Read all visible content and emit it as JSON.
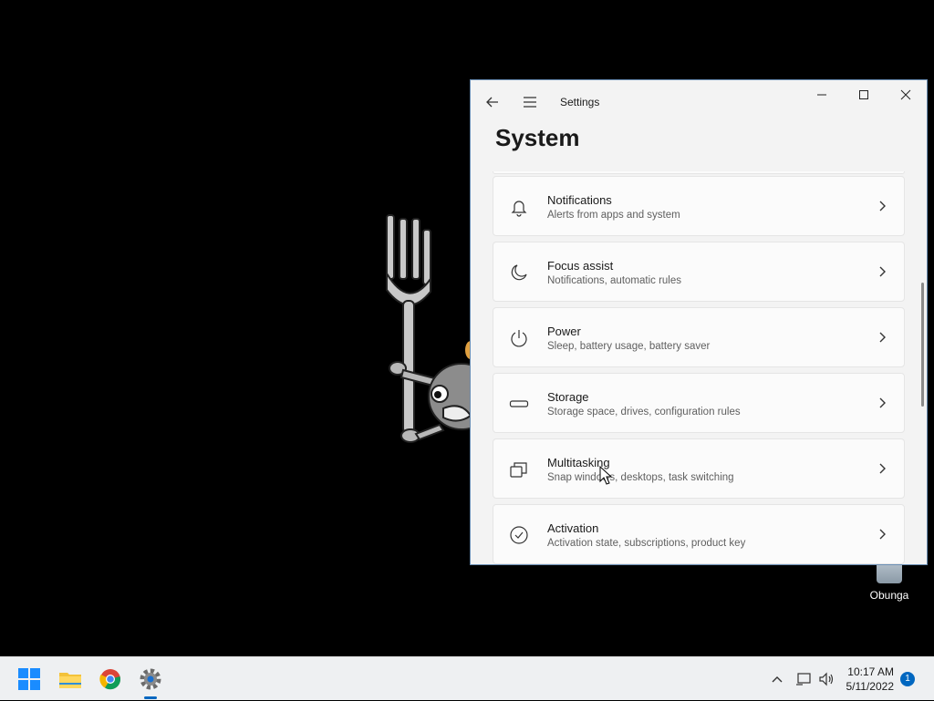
{
  "window": {
    "title": "Settings",
    "page_title": "System"
  },
  "settings_items": [
    {
      "name": "Notifications",
      "desc": "Alerts from apps and system",
      "icon": "bell-icon"
    },
    {
      "name": "Focus assist",
      "desc": "Notifications, automatic rules",
      "icon": "moon-icon"
    },
    {
      "name": "Power",
      "desc": "Sleep, battery usage, battery saver",
      "icon": "power-icon"
    },
    {
      "name": "Storage",
      "desc": "Storage space, drives, configuration rules",
      "icon": "storage-icon"
    },
    {
      "name": "Multitasking",
      "desc": "Snap windows, desktops, task switching",
      "icon": "multitasking-icon"
    },
    {
      "name": "Activation",
      "desc": "Activation state, subscriptions, product key",
      "icon": "check-circle-icon"
    }
  ],
  "desktop": {
    "icon_label": "Obunga"
  },
  "taskbar": {
    "apps": [
      "start-icon",
      "file-explorer-icon",
      "chrome-icon",
      "settings-icon"
    ],
    "time": "10:17 AM",
    "date": "5/11/2022",
    "notification_count": "1"
  },
  "colors": {
    "accent": "#0067c0",
    "window_border": "#6b8fb5",
    "window_bg": "#f3f3f3",
    "card_bg": "#fbfbfb"
  }
}
